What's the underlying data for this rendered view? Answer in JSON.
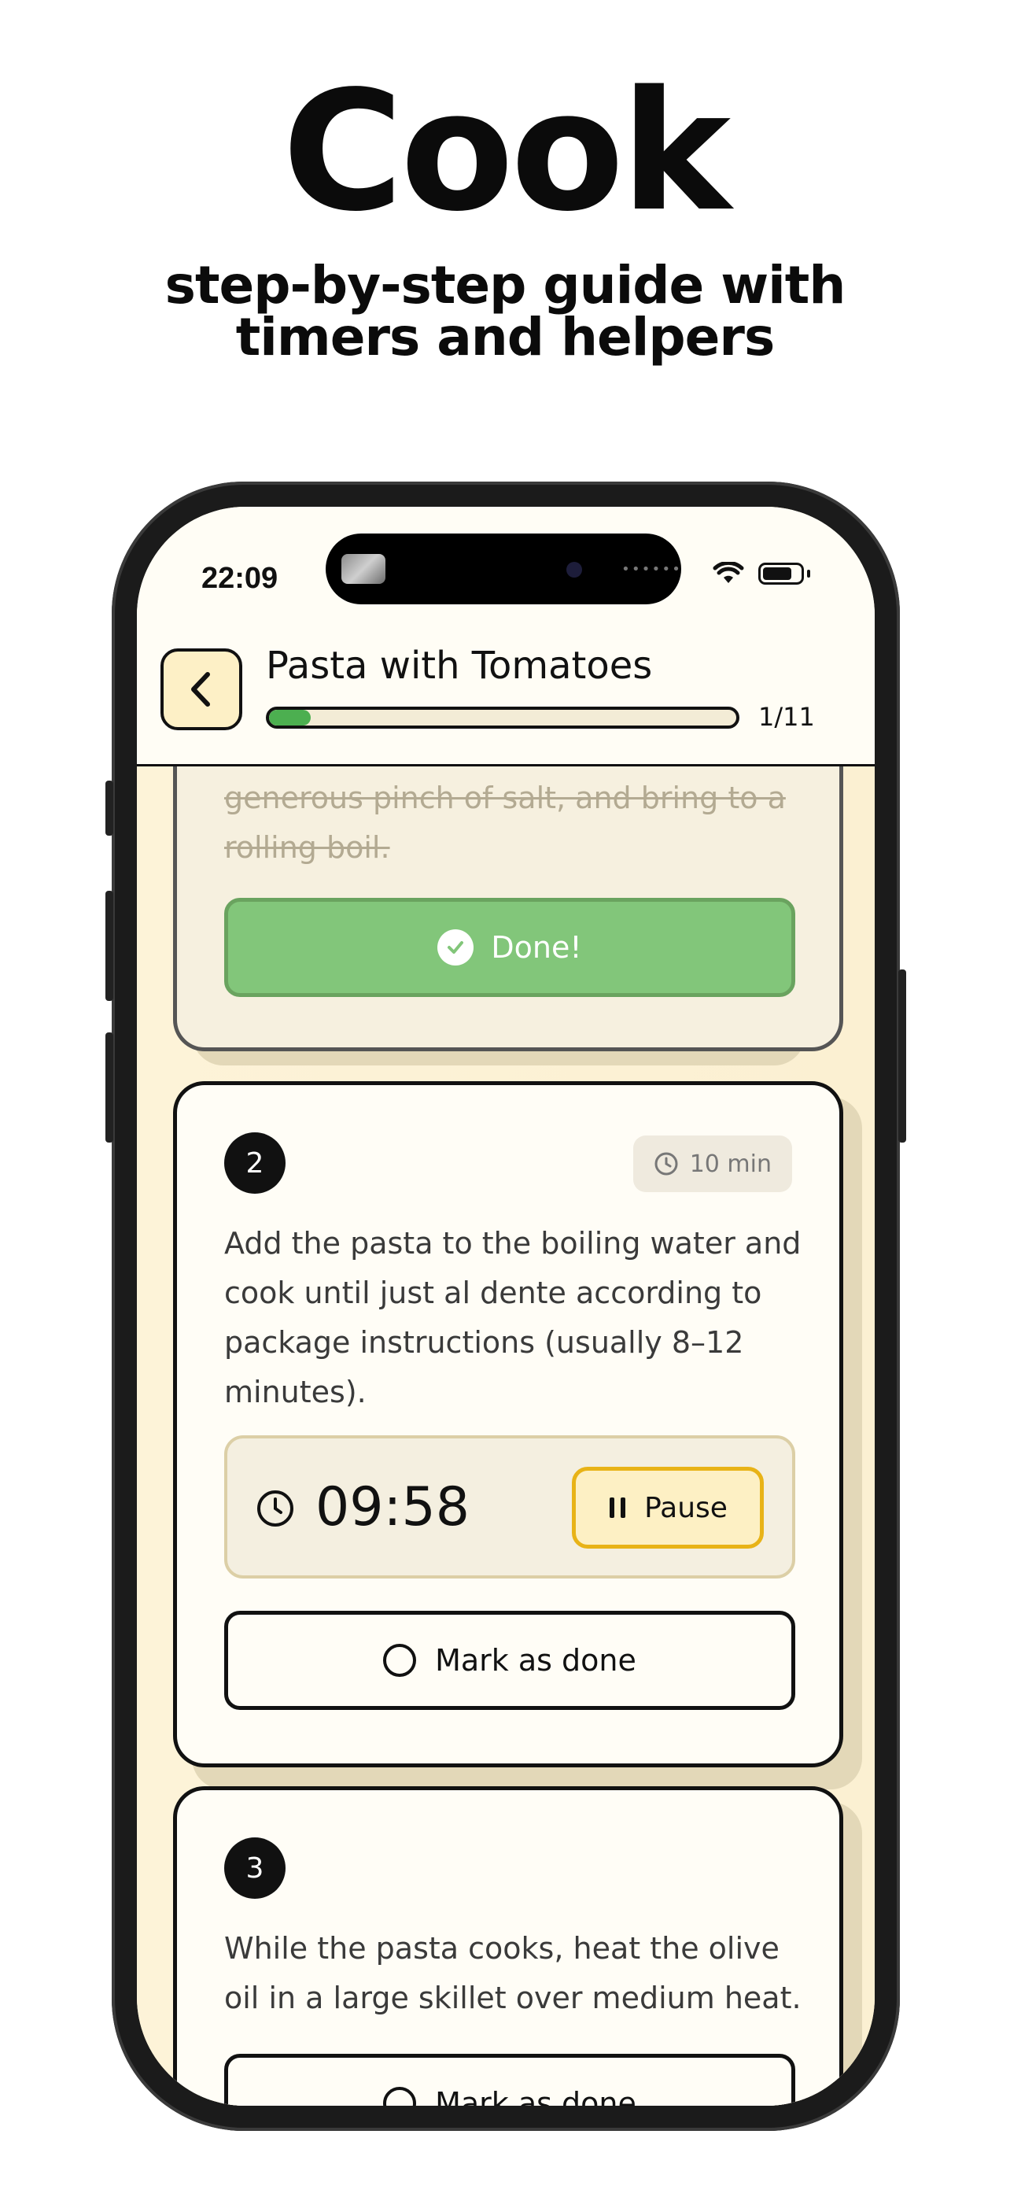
{
  "hero": {
    "title": "Cook",
    "subtitle_line1": "step-by-step guide with",
    "subtitle_line2": "timers and helpers"
  },
  "status_bar": {
    "time": "22:09",
    "icons": [
      "wifi-icon",
      "battery-icon"
    ]
  },
  "header": {
    "back_icon": "chevron-left-icon",
    "recipe_title": "Pasta with Tomatoes",
    "progress_label": "1/11",
    "progress_fraction": 0.09
  },
  "steps": [
    {
      "state": "done",
      "text_line1": "generous pinch of salt, and bring to a",
      "text_line2": "rolling boil.",
      "done_label": "Done!"
    },
    {
      "number": "2",
      "duration": "10 min",
      "text_lines": [
        "Add the pasta to the boiling water and",
        "cook until just al dente according to",
        "package instructions (usually 8–12",
        "minutes)."
      ],
      "timer": {
        "value": "09:58",
        "pause_label": "Pause"
      },
      "mark_label": "Mark as done"
    },
    {
      "number": "3",
      "text_lines": [
        "While the pasta cooks, heat the olive",
        "oil in a large skillet over medium heat."
      ],
      "mark_label": "Mark as done"
    }
  ],
  "colors": {
    "accent_green": "#4caf50",
    "done_green": "#82c67a",
    "pause_yellow": "#e8b317",
    "background_cream": "#fdf3d8"
  }
}
